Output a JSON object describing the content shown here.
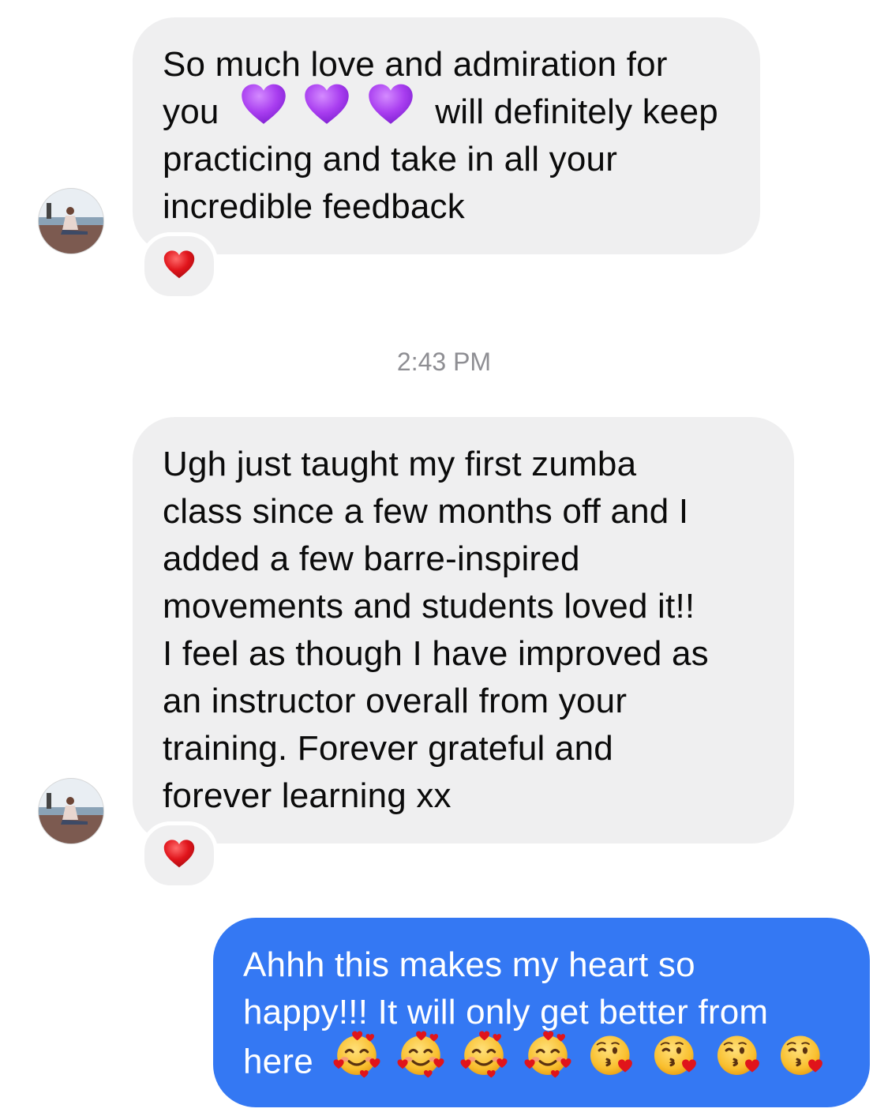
{
  "messages": [
    {
      "direction": "incoming",
      "lines": [
        "So much love and admiration for",
        "will definitely keep",
        "practicing and take in all your",
        "incredible feedback"
      ],
      "line1_prefix": "you",
      "inline_emojis": [
        "purple-heart",
        "purple-heart",
        "purple-heart"
      ],
      "reaction": "red-heart"
    },
    {
      "direction": "incoming",
      "lines": [
        "Ugh just taught my first zumba",
        "class since a few months off and I",
        "added a few barre-inspired",
        "movements and students loved it!!",
        "I feel as though I have improved as",
        "an instructor overall from your",
        "training. Forever grateful and",
        "forever learning xx"
      ],
      "reaction": "red-heart"
    },
    {
      "direction": "outgoing",
      "lines": [
        "Ahhh this makes my heart so",
        "happy!!! It will only get better from",
        "here"
      ],
      "trailing_emojis": [
        "smiling-face-with-hearts",
        "smiling-face-with-hearts",
        "smiling-face-with-hearts",
        "smiling-face-with-hearts",
        "kissing-face-blowing-kiss",
        "kissing-face-blowing-kiss",
        "kissing-face-blowing-kiss",
        "kissing-face-blowing-kiss"
      ]
    }
  ],
  "timestamp": "2:43 PM",
  "colors": {
    "incoming_bubble": "#efeff0",
    "outgoing_bubble": "#3478f3",
    "timestamp_text": "#8e8e93",
    "purple_heart": "#a93ef0",
    "red_heart": "#e0141b"
  }
}
